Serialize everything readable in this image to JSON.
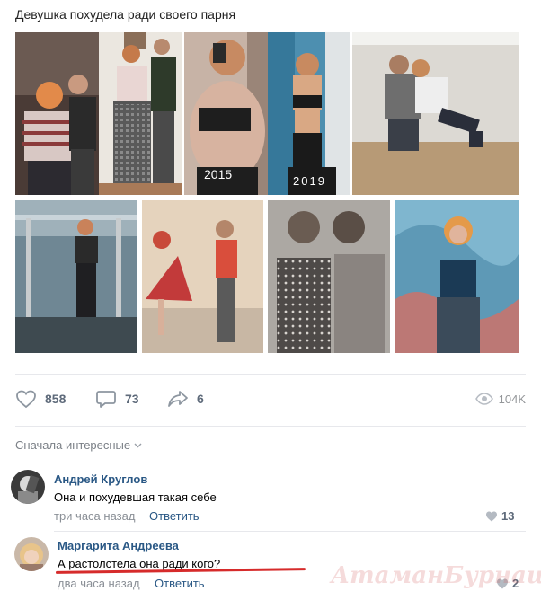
{
  "post": {
    "text": "Девушка похудела ради своего парня"
  },
  "photos": [
    {
      "name": "photo-couple-before",
      "bg": "#c9a592"
    },
    {
      "name": "photo-couple-standing",
      "bg": "#e9e5de"
    },
    {
      "name": "photo-selfie-2015",
      "bg": "#b79c8e",
      "label": "2015"
    },
    {
      "name": "photo-selfie-2019",
      "bg": "#5f8fa8",
      "label": "2019"
    },
    {
      "name": "photo-couple-plank",
      "bg": "#d8d5cf"
    },
    {
      "name": "photo-gym-pullup",
      "bg": "#7a8f9c"
    },
    {
      "name": "photo-couple-dance",
      "bg": "#dfc3a8"
    },
    {
      "name": "photo-couple-embrace",
      "bg": "#9a9795"
    },
    {
      "name": "photo-woman-graffiti",
      "bg": "#6aa0b8"
    }
  ],
  "actions": {
    "likes": "858",
    "comments": "73",
    "shares": "6",
    "views": "104K"
  },
  "sort_label": "Сначала интересные",
  "comments": [
    {
      "author": "Андрей Круглов",
      "text": "Она и похудевшая такая себе",
      "time": "три часа назад",
      "reply": "Ответить",
      "likes": "13"
    },
    {
      "author": "Маргарита Андреева",
      "text": "А растолстела она ради кого?",
      "time": "два часа назад",
      "reply": "Ответить",
      "likes": "2"
    }
  ],
  "watermark": "АтаманБурнаш.блог.РФ",
  "colors": {
    "link": "#2a5885",
    "muted": "#8a8f96",
    "underline": "#d62b2b"
  }
}
